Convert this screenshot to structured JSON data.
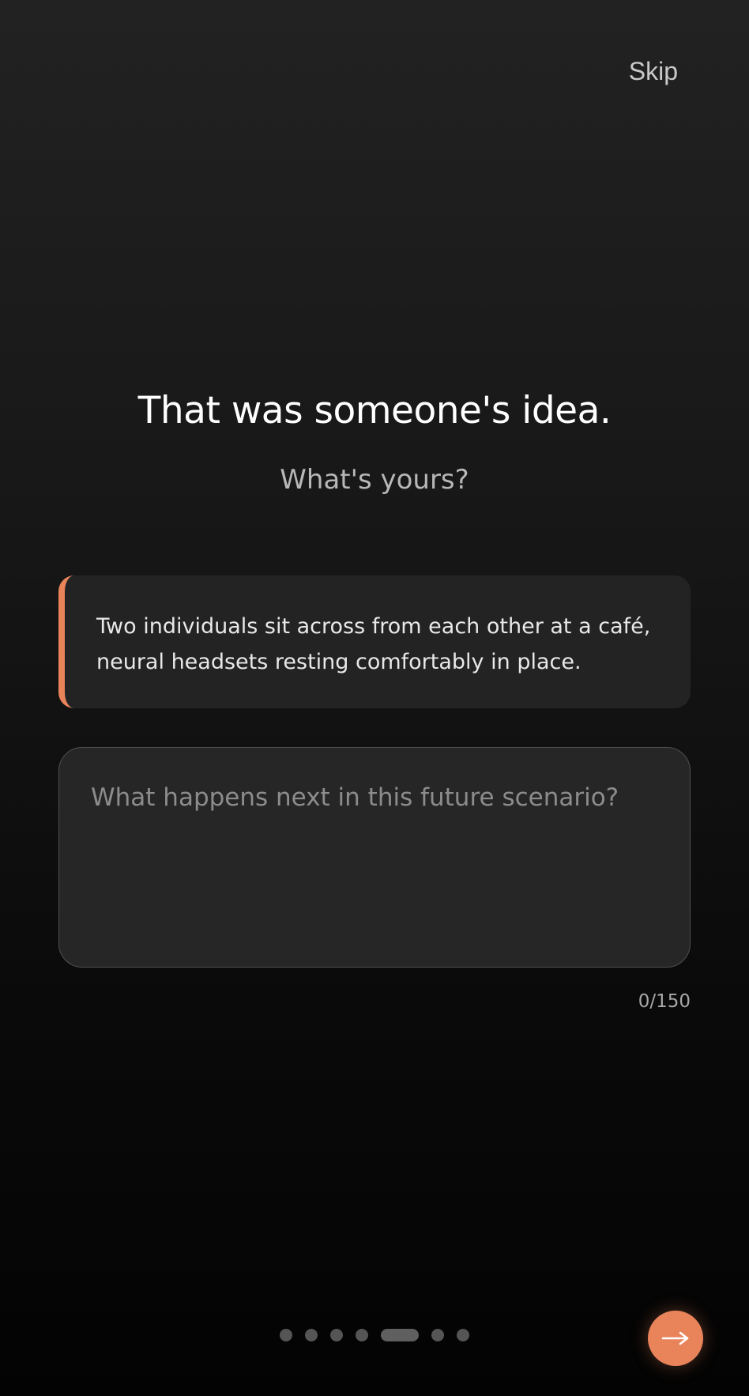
{
  "header": {
    "skip_label": "Skip"
  },
  "main": {
    "headline": "That was someone's idea.",
    "subhead": "What's yours?",
    "scenario": {
      "text": "Two individuals sit across from each other at a café, neural headsets resting comfortably in place."
    },
    "answer": {
      "value": "",
      "placeholder": "What happens next in this future scenario?",
      "counter": "0/150"
    }
  },
  "footer": {
    "pager": {
      "total": 7,
      "active_index": 4
    },
    "next_icon": "arrow-right-icon"
  },
  "colors": {
    "accent": "#e8835a",
    "background_top": "#222222",
    "background_bottom": "#030303"
  }
}
